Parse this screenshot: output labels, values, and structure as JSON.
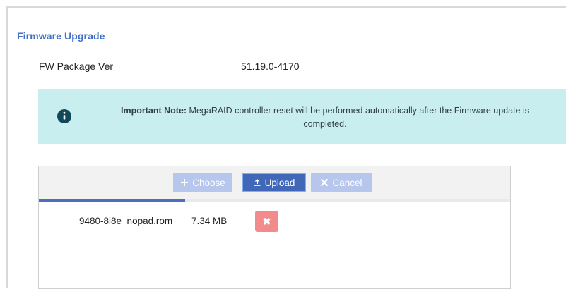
{
  "section": {
    "title": "Firmware Upgrade"
  },
  "firmware": {
    "package_label": "FW Package Ver",
    "package_value": "51.19.0-4170"
  },
  "note": {
    "icon": "info-icon",
    "label": "Important Note:",
    "message": "MegaRAID controller reset will be performed automatically after the Firmware update is completed."
  },
  "uploader": {
    "buttons": {
      "choose": "Choose",
      "upload": "Upload",
      "cancel": "Cancel"
    },
    "progress_fraction": 0.31,
    "files": [
      {
        "name": "9480-8i8e_nopad.rom",
        "size": "7.34 MB",
        "remove_icon": "close-icon"
      }
    ]
  },
  "colors": {
    "title": "#3f6fc6",
    "note_background": "#c9eef0",
    "primary_button": "#4168b8",
    "disabled_button": "#b7c6ec",
    "remove_button": "#f28b8b"
  }
}
